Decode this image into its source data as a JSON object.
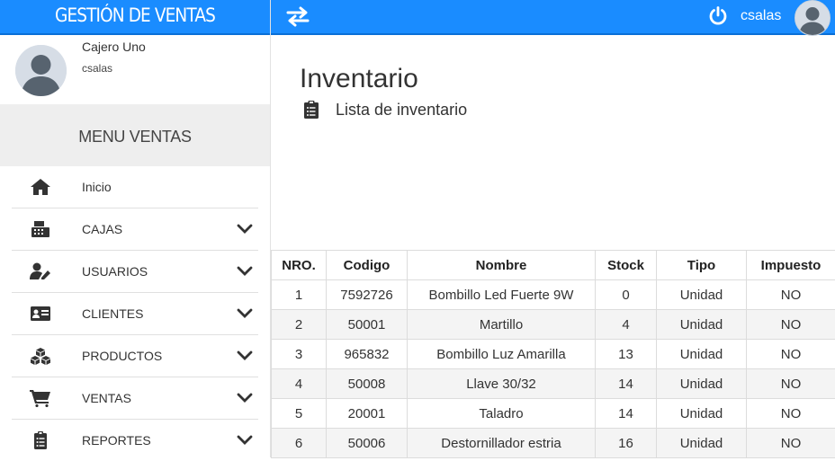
{
  "brand": "GESTIÓN DE VENTAS",
  "user": {
    "name": "Cajero Uno",
    "login": "csalas"
  },
  "menu_title": "MENU VENTAS",
  "menu": [
    {
      "label": "Inicio",
      "icon": "home-icon",
      "has_submenu": false
    },
    {
      "label": "CAJAS",
      "icon": "cash-register-icon",
      "has_submenu": true
    },
    {
      "label": "USUARIOS",
      "icon": "user-edit-icon",
      "has_submenu": true
    },
    {
      "label": "CLIENTES",
      "icon": "id-card-icon",
      "has_submenu": true
    },
    {
      "label": "PRODUCTOS",
      "icon": "boxes-icon",
      "has_submenu": true
    },
    {
      "label": "VENTAS",
      "icon": "cart-icon",
      "has_submenu": true
    },
    {
      "label": "REPORTES",
      "icon": "clipboard-icon",
      "has_submenu": true
    }
  ],
  "topbar": {
    "username": "csalas"
  },
  "page": {
    "title": "Inventario",
    "subtitle": "Lista de inventario"
  },
  "table": {
    "headers": [
      "NRO.",
      "Codigo",
      "Nombre",
      "Stock",
      "Tipo",
      "Impuesto"
    ],
    "rows": [
      [
        "1",
        "7592726",
        "Bombillo Led Fuerte 9W",
        "0",
        "Unidad",
        "NO"
      ],
      [
        "2",
        "50001",
        "Martillo",
        "4",
        "Unidad",
        "NO"
      ],
      [
        "3",
        "965832",
        "Bombillo Luz Amarilla",
        "13",
        "Unidad",
        "NO"
      ],
      [
        "4",
        "50008",
        "Llave 30/32",
        "14",
        "Unidad",
        "NO"
      ],
      [
        "5",
        "20001",
        "Taladro",
        "14",
        "Unidad",
        "NO"
      ],
      [
        "6",
        "50006",
        "Destornillador estria",
        "16",
        "Unidad",
        "NO"
      ]
    ]
  },
  "colors": {
    "primary": "#1a8cff",
    "menu_bg": "#eeeeee"
  }
}
